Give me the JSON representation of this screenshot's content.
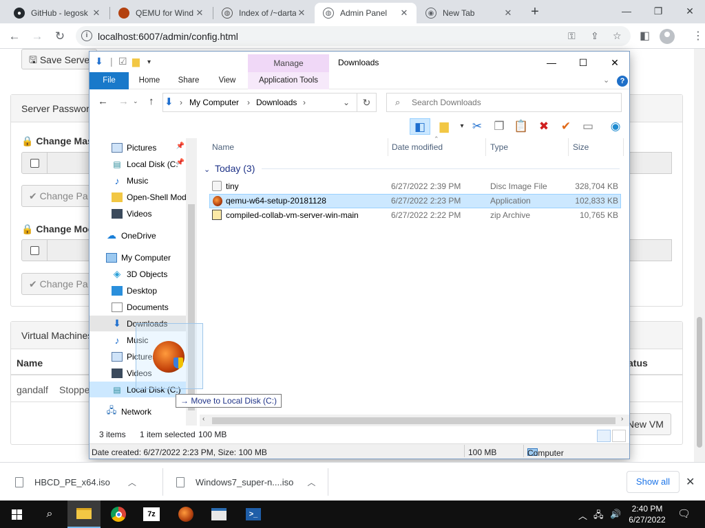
{
  "browser": {
    "tabs": [
      {
        "title": "GitHub - legosk",
        "favicon_color": "#24292e",
        "favicon": "github-icon"
      },
      {
        "title": "QEMU for Wind",
        "favicon_color": "#b3410f",
        "favicon": "qemu-icon"
      },
      {
        "title": "Index of /~darta",
        "favicon_color": "#555555",
        "favicon": "globe-icon"
      },
      {
        "title": "Admin Panel",
        "favicon_color": "#5f6368",
        "favicon": "globe-icon",
        "active": true
      },
      {
        "title": "New Tab",
        "favicon_color": "#5f6368",
        "favicon": "chrome-icon"
      }
    ],
    "url": "localhost:6007/admin/config.html"
  },
  "admin": {
    "save_button": "Save Serve",
    "server_password_heading": "Server Passwor",
    "change_master_label": "Change Mas",
    "change_master_button": "Change Pa",
    "change_mod_label": "Change Moc",
    "change_mod_button": "Change Pa",
    "vm_heading": "Virtual Machines",
    "col_name": "Name",
    "col_status": "atus",
    "vm_name": "gandalf",
    "vm_state": "Stoppe",
    "new_vm_button": "New VM"
  },
  "explorer": {
    "caption": "Downloads",
    "manage_tab": "Manage",
    "ribbon_tabs": [
      "File",
      "Home",
      "Share",
      "View",
      "Application Tools"
    ],
    "breadcrumb": [
      "My Computer",
      "Downloads"
    ],
    "search_placeholder": "Search Downloads",
    "nav_items": [
      {
        "label": "Pictures",
        "icon": "pictures-icon",
        "pinned": true
      },
      {
        "label": "Local Disk (C:",
        "icon": "disk-icon",
        "pinned": true
      },
      {
        "label": "Music",
        "icon": "music-icon"
      },
      {
        "label": "Open-Shell Mod",
        "icon": "folder-icon"
      },
      {
        "label": "Videos",
        "icon": "videos-icon"
      },
      {
        "label": "OneDrive",
        "icon": "onedrive-icon"
      },
      {
        "label": "My Computer",
        "icon": "computer-icon"
      },
      {
        "label": "3D Objects",
        "icon": "3d-objects-icon"
      },
      {
        "label": "Desktop",
        "icon": "desktop-icon"
      },
      {
        "label": "Documents",
        "icon": "documents-icon"
      },
      {
        "label": "Downloads",
        "icon": "downloads-icon",
        "selected": true
      },
      {
        "label": "Music",
        "icon": "music-icon"
      },
      {
        "label": "Pictures",
        "icon": "pictures-icon"
      },
      {
        "label": "Videos",
        "icon": "videos-icon"
      },
      {
        "label": "Local Disk (C:)",
        "icon": "disk-icon",
        "hover": true
      },
      {
        "label": "Network",
        "icon": "network-icon"
      }
    ],
    "columns": [
      "Name",
      "Date modified",
      "Type",
      "Size"
    ],
    "group_label": "Today (3)",
    "files": [
      {
        "name": "tiny",
        "date": "6/27/2022 2:39 PM",
        "type": "Disc Image File",
        "size": "328,704 KB",
        "icon": "disc-image-icon"
      },
      {
        "name": "qemu-w64-setup-20181128",
        "date": "6/27/2022 2:23 PM",
        "type": "Application",
        "size": "102,833 KB",
        "icon": "qemu-installer-icon",
        "selected": true
      },
      {
        "name": "compiled-collab-vm-server-win-main",
        "date": "6/27/2022 2:22 PM",
        "type": "zip Archive",
        "size": "10,765 KB",
        "icon": "zip-archive-icon"
      }
    ],
    "drag_tooltip": "Move to Local Disk (C:)",
    "status_count": "3 items",
    "status_selected": "1 item selected",
    "status_size": "100 MB",
    "details_text": "Date created: 6/27/2022 2:23 PM, Size: 100 MB",
    "details_size": "100 MB",
    "details_location": "Computer"
  },
  "downloads_shelf": {
    "items": [
      "HBCD_PE_x64.iso",
      "Windows7_super-n....iso"
    ],
    "show_all": "Show all"
  },
  "taskbar": {
    "time": "2:40 PM",
    "date": "6/27/2022"
  }
}
